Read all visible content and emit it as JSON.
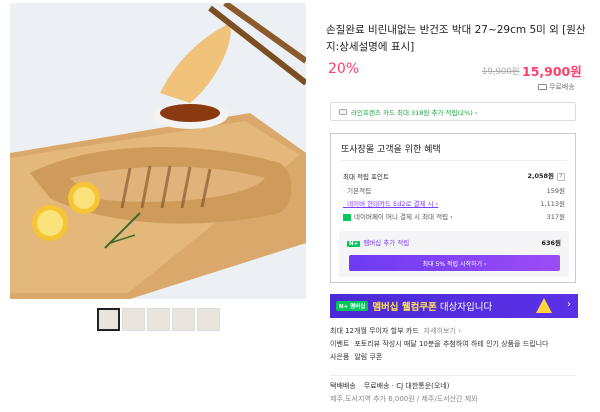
{
  "product": {
    "title": "손질완료 비린내없는 반건조 박대 27~29cm 5미 외 [원산지:상세설명에 표시]",
    "discount": "20%",
    "original_price": "19,900원",
    "price": "15,900원",
    "shipping_badge": "무료배송"
  },
  "card_banner": {
    "text": "라인프렌즈 카드 최대 318원 추가 적립(2%) ›"
  },
  "benefits": {
    "title": "또사장몰 고객을 위한 혜택",
    "max_points_label": "최대 적립 포인트",
    "max_points_value": "2,058원",
    "help": "?",
    "rows": [
      {
        "label": "기본적립",
        "value": "159원"
      },
      {
        "label": "네이버 현대카드 Ed2로 결제 시 ›",
        "value": "1,113원"
      },
      {
        "label": "네이버페이 머니 결제 시 최대 적립 ›",
        "value": "317원"
      }
    ],
    "member": {
      "badge": "N+",
      "label": "멤버십 추가 적립",
      "value": "636원",
      "button": "최대 5% 적립 시작하기 ›"
    }
  },
  "coupon": {
    "badge": "N+ 멤버십",
    "title": "멤버십 웰컴쿠폰",
    "subtitle": "대상자입니다",
    "arrow": "›"
  },
  "info_lines": [
    {
      "label": "최대 12개월 무이자 할부 카드",
      "extra": "자세히보기 ›"
    },
    {
      "label": "이벤트",
      "extra": "포토리뷰 작성시 매달 10분을 추첨하여 하테 인기 상품을 드립니다"
    },
    {
      "label": "사은품",
      "extra": "알림 쿠폰"
    }
  ],
  "shipping": {
    "line1_label": "택배배송",
    "line1_value": "무료배송 · CJ 대한통운(오네)",
    "line2": "제주,도서지역 추가 6,000원 / 제주/도서산간 제외"
  },
  "colors": {
    "accent": "#ff3e6c",
    "purple": "#6d3bf3",
    "naver_green": "#03c75a",
    "coupon_bg": "#4b2bd6"
  }
}
